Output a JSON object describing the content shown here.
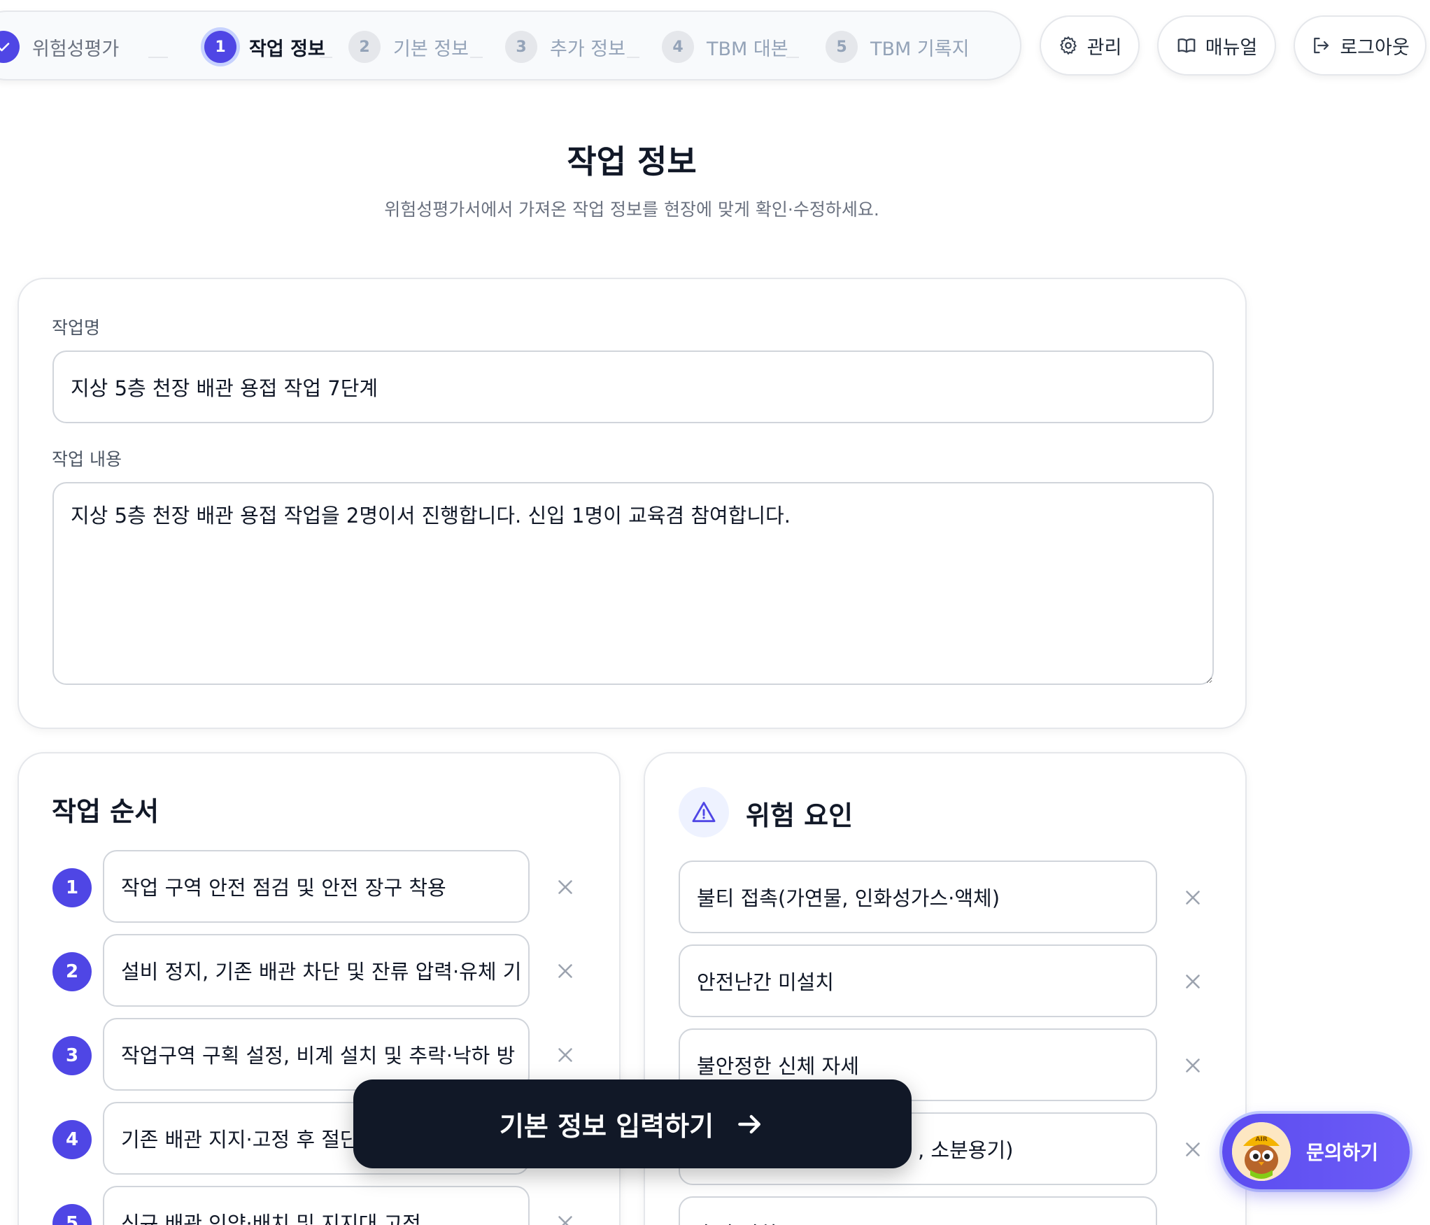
{
  "stepper": {
    "steps": [
      {
        "num": "✓",
        "label": "위험성평가",
        "state": "done"
      },
      {
        "num": "1",
        "label": "작업 정보",
        "state": "active"
      },
      {
        "num": "2",
        "label": "기본 정보",
        "state": "upcoming"
      },
      {
        "num": "3",
        "label": "추가 정보",
        "state": "upcoming"
      },
      {
        "num": "4",
        "label": "TBM 대본",
        "state": "upcoming"
      },
      {
        "num": "5",
        "label": "TBM 기록지",
        "state": "upcoming"
      }
    ]
  },
  "header_actions": {
    "admin_label": "관리",
    "manual_label": "매뉴얼",
    "logout_label": "로그아웃"
  },
  "page": {
    "title": "작업 정보",
    "subtitle": "위험성평가서에서 가져온 작업 정보를 현장에 맞게 확인·수정하세요."
  },
  "task_form": {
    "name_label": "작업명",
    "name_value": "지상 5층 천장 배관 용접 작업 7단계",
    "content_label": "작업 내용",
    "content_value": "지상 5층 천장 배관 용접 작업을 2명이서 진행합니다. 신입 1명이 교육겸 참여합니다."
  },
  "work_order": {
    "title": "작업 순서",
    "steps": [
      {
        "num": "1",
        "text": "작업 구역 안전 점검 및 안전 장구 착용"
      },
      {
        "num": "2",
        "text": "설비 정지, 기존 배관 차단 및 잔류 압력·유체 기"
      },
      {
        "num": "3",
        "text": "작업구역 구획 설정, 비계 설치 및 추락·낙하 방"
      },
      {
        "num": "4",
        "text": "기존 배관 지지·고정 후 절단"
      },
      {
        "num": "5",
        "text": "신규 배관 인양·배치 및 지지대 고정"
      }
    ]
  },
  "hazards": {
    "title": "위험 요인",
    "items": [
      {
        "text": "불티 접촉(가연물, 인화성가스·액체)"
      },
      {
        "text": "안전난간 미설치"
      },
      {
        "text": "불안정한 신체 자세"
      },
      {
        "text": ", 소분용기)"
      },
      {
        "text": "추락 낙하"
      }
    ]
  },
  "cta": {
    "label": "기본 정보 입력하기"
  },
  "help": {
    "label": "문의하기",
    "mascot_badge": "AIR"
  },
  "colors": {
    "primary": "#4f46e5",
    "dark": "#111827",
    "border": "#d1d5db",
    "muted": "#94a3b8"
  }
}
